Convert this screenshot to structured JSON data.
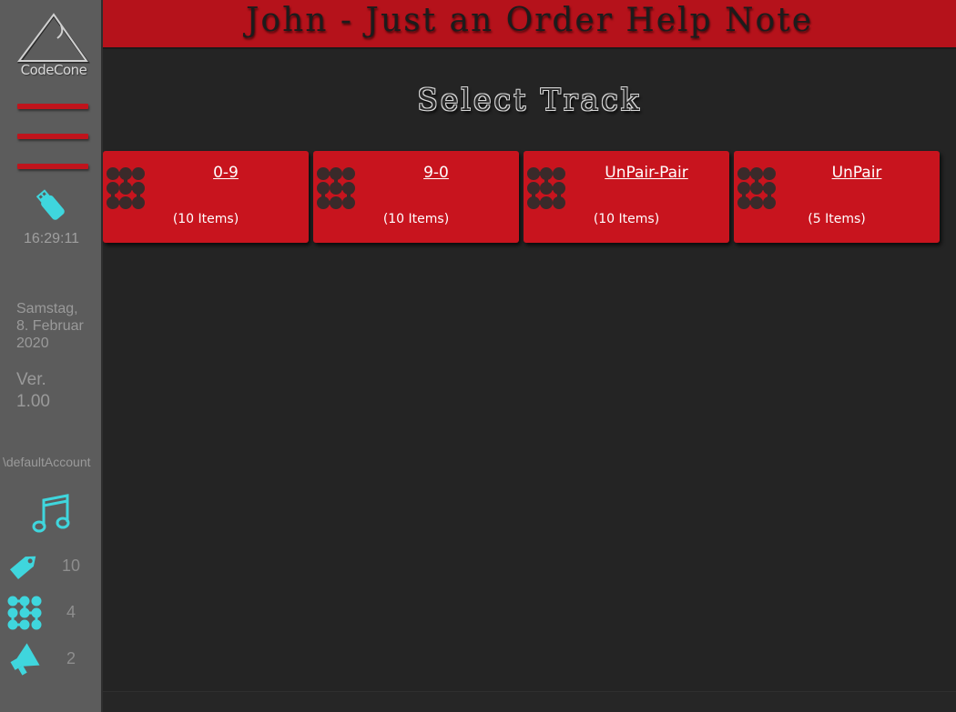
{
  "header": {
    "title": "John - Just an Order Help Note"
  },
  "sidebar": {
    "logo_text": "CodeCone",
    "time": "16:29:11",
    "date_line1": "Samstag,",
    "date_line2": "8. Februar",
    "date_line3": "2020",
    "version_label": "Ver.",
    "version_value": "1.00",
    "account": "\\defaultAccount",
    "stats": [
      {
        "icon": "tag-icon",
        "count": "10"
      },
      {
        "icon": "dots-grid-icon",
        "count": "4"
      },
      {
        "icon": "megaphone-icon",
        "count": "2"
      }
    ]
  },
  "main": {
    "section_title": "Select Track",
    "tracks": [
      {
        "name": "0-9",
        "count": "(10 Items)"
      },
      {
        "name": "9-0",
        "count": "(10 Items)"
      },
      {
        "name": "UnPair-Pair",
        "count": "(10 Items)"
      },
      {
        "name": "UnPair",
        "count": "(5 Items)"
      }
    ]
  },
  "colors": {
    "accent_red": "#c8141e",
    "icon_cyan": "#3fd6dd",
    "sidebar_bg": "#5c5c5c",
    "main_bg": "#242424"
  }
}
